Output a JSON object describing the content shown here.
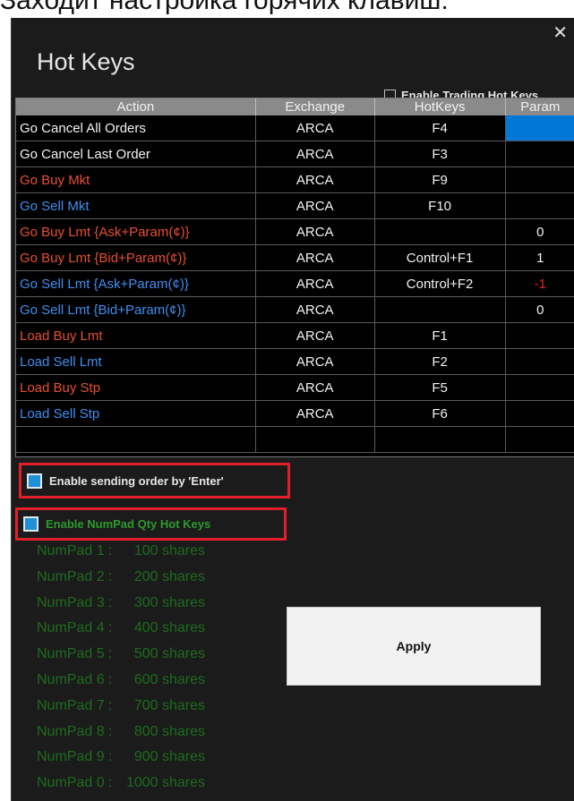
{
  "top_caption": "Заходит настройка горячих клавиш:",
  "window": {
    "title": "Hot Keys",
    "close_glyph": "✕",
    "enable_trading_label": "Enable Trading Hot Keys"
  },
  "grid": {
    "columns": [
      "Action",
      "Exchange",
      "HotKeys",
      "Param"
    ],
    "rows": [
      {
        "action": "Go Cancel All Orders",
        "color": "white",
        "exchange": "ARCA",
        "hotkey": "F4",
        "param": "",
        "param_selected": true
      },
      {
        "action": "Go Cancel Last Order",
        "color": "white",
        "exchange": "ARCA",
        "hotkey": "F3",
        "param": ""
      },
      {
        "action": "Go Buy Mkt",
        "color": "red",
        "exchange": "ARCA",
        "hotkey": "F9",
        "param": ""
      },
      {
        "action": "Go Sell Mkt",
        "color": "blue",
        "exchange": "ARCA",
        "hotkey": "F10",
        "param": ""
      },
      {
        "action": "Go Buy Lmt {Ask+Param(¢)}",
        "color": "red",
        "exchange": "ARCA",
        "hotkey": "",
        "param": "0"
      },
      {
        "action": "Go Buy Lmt {Bid+Param(¢)}",
        "color": "red",
        "exchange": "ARCA",
        "hotkey": "Control+F1",
        "param": "1"
      },
      {
        "action": "Go Sell Lmt {Ask+Param(¢)}",
        "color": "blue",
        "exchange": "ARCA",
        "hotkey": "Control+F2",
        "param": "-1",
        "param_negative": true
      },
      {
        "action": "Go Sell Lmt {Bid+Param(¢)}",
        "color": "blue",
        "exchange": "ARCA",
        "hotkey": "",
        "param": "0"
      },
      {
        "action": "Load Buy Lmt",
        "color": "red",
        "exchange": "ARCA",
        "hotkey": "F1",
        "param": ""
      },
      {
        "action": "Load Sell Lmt",
        "color": "blue",
        "exchange": "ARCA",
        "hotkey": "F2",
        "param": ""
      },
      {
        "action": "Load Buy Stp",
        "color": "red",
        "exchange": "ARCA",
        "hotkey": "F5",
        "param": ""
      },
      {
        "action": "Load Sell Stp",
        "color": "blue",
        "exchange": "ARCA",
        "hotkey": "F6",
        "param": ""
      }
    ]
  },
  "options": {
    "enter_label": "Enable sending order by 'Enter'",
    "numpad_label": "Enable NumPad Qty Hot Keys"
  },
  "numpad": [
    {
      "key": "NumPad 1 :",
      "value": "100 shares"
    },
    {
      "key": "NumPad 2 :",
      "value": "200 shares"
    },
    {
      "key": "NumPad 3 :",
      "value": "300 shares"
    },
    {
      "key": "NumPad 4 :",
      "value": "400 shares"
    },
    {
      "key": "NumPad 5 :",
      "value": "500 shares"
    },
    {
      "key": "NumPad 6 :",
      "value": "600 shares"
    },
    {
      "key": "NumPad 7 :",
      "value": "700 shares"
    },
    {
      "key": "NumPad 8 :",
      "value": "800 shares"
    },
    {
      "key": "NumPad 9 :",
      "value": "900 shares"
    },
    {
      "key": "NumPad 0 :",
      "value": "1000 shares"
    }
  ],
  "apply_label": "Apply",
  "colors": {
    "action_white": "#f2f2f2",
    "action_red": "#e8502d",
    "action_blue": "#3e8ff0",
    "highlight_border": "#e01f2a",
    "numpad_text": "#1e6b1e",
    "selected_cell": "#0078d7"
  }
}
